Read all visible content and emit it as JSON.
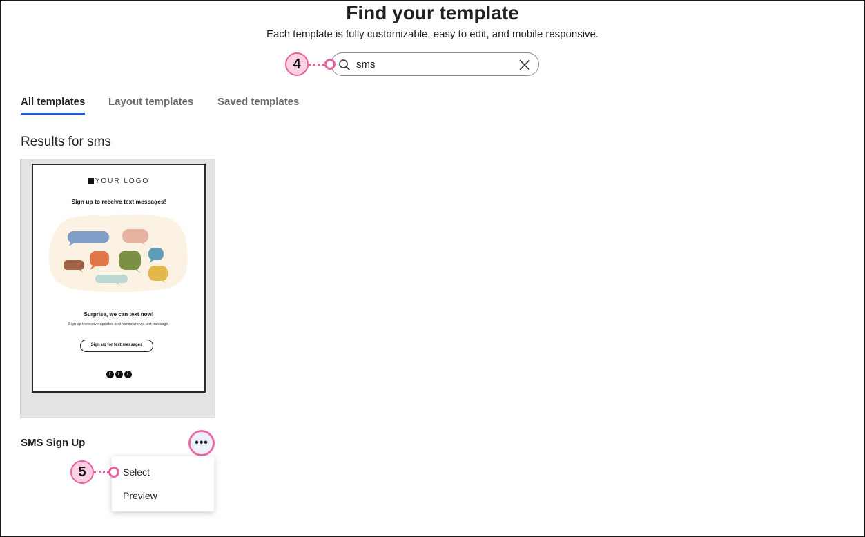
{
  "header": {
    "title": "Find your template",
    "subtitle": "Each template is fully customizable, easy to edit, and mobile responsive."
  },
  "search": {
    "value": "sms",
    "icon": "search-icon",
    "clear_icon": "close-icon"
  },
  "tabs": [
    {
      "label": "All templates",
      "active": true
    },
    {
      "label": "Layout templates",
      "active": false
    },
    {
      "label": "Saved templates",
      "active": false
    }
  ],
  "results_heading": "Results for sms",
  "template_card": {
    "name": "SMS Sign Up",
    "preview": {
      "logo_text": "YOUR LOGO",
      "headline": "Sign up to receive text messages!",
      "subheading": "Surprise, we can text now!",
      "body": "Sign up to receive updates and reminders via text message.",
      "button": "Sign up for text messages",
      "social": [
        "f",
        "t",
        "i"
      ]
    },
    "more_icon": "more-horizontal-icon"
  },
  "menu": {
    "items": [
      "Select",
      "Preview"
    ]
  },
  "callouts": [
    "4",
    "5"
  ],
  "colors": {
    "accent_tab": "#1a5fe0",
    "callout_pink": "#ec5fa0",
    "callout_fill": "#fbd0e3"
  }
}
